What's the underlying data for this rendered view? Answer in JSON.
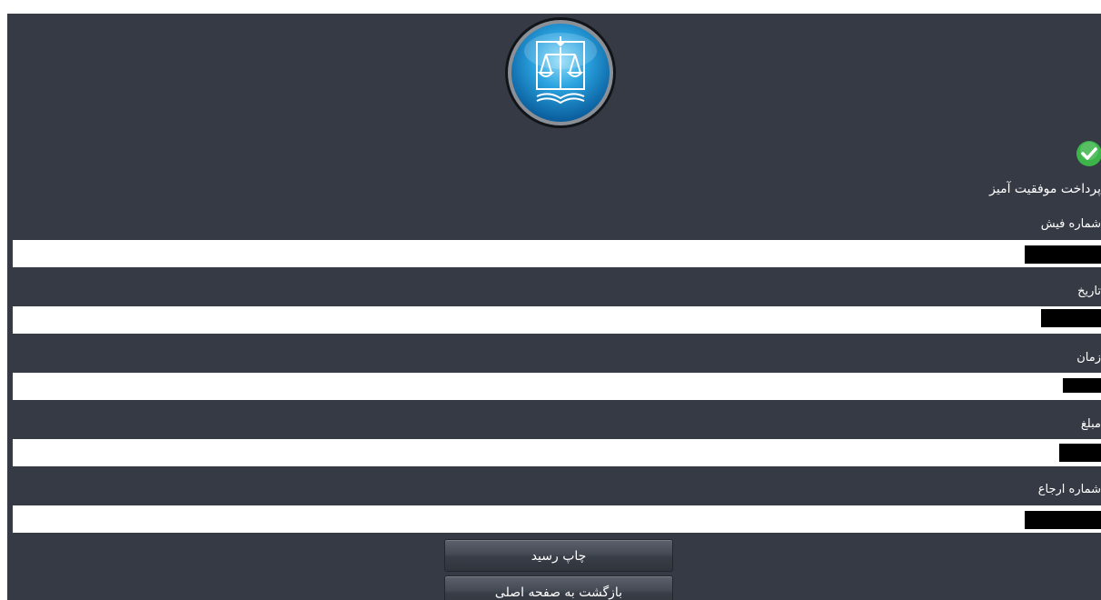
{
  "header": {
    "logo_icon": "justice-scales-emblem-icon"
  },
  "status": {
    "icon": "check-circle-icon",
    "icon_color": "#3cb449",
    "text": "پرداخت موفقیت آمیز"
  },
  "fields": [
    {
      "label": "شماره فیش",
      "value_redacted": true
    },
    {
      "label": "تاریخ",
      "value_redacted": true
    },
    {
      "label": "زمان",
      "value_redacted": true
    },
    {
      "label": "مبلغ",
      "value_redacted": true
    },
    {
      "label": "شماره ارجاع",
      "value_redacted": true
    }
  ],
  "actions": {
    "print_label": "چاپ رسید",
    "back_label": "بازگشت به صفحه اصلی"
  }
}
